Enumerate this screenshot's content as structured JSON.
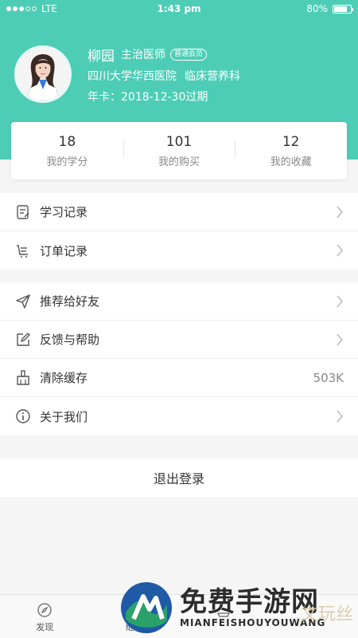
{
  "status_bar": {
    "carrier": "LTE",
    "time": "1:43 pm",
    "battery": "80%",
    "battery_level": 0.8
  },
  "profile": {
    "name": "柳园",
    "title": "主治医师",
    "membership_badge": "普通会员",
    "hospital": "四川大学华西医院",
    "department": "临床营养科",
    "card_status": "年卡：2018-12-30过期"
  },
  "stats": [
    {
      "value": "18",
      "label": "我的学分"
    },
    {
      "value": "101",
      "label": "我的购买"
    },
    {
      "value": "12",
      "label": "我的收藏"
    }
  ],
  "menu_groups": {
    "records": [
      {
        "label": "学习记录",
        "icon": "study-record-icon"
      },
      {
        "label": "订单记录",
        "icon": "order-record-icon"
      }
    ],
    "settings": [
      {
        "label": "推荐给好友",
        "icon": "share-icon"
      },
      {
        "label": "反馈与帮助",
        "icon": "feedback-icon"
      },
      {
        "label": "清除缓存",
        "icon": "clear-cache-icon",
        "value": "503K"
      },
      {
        "label": "关于我们",
        "icon": "info-icon"
      }
    ]
  },
  "logout_label": "退出登录",
  "tabs": [
    {
      "label": "发现",
      "icon": "compass-icon"
    },
    {
      "label": "继续",
      "icon": "continue-icon"
    },
    {
      "label": "",
      "icon": "study-icon"
    },
    {
      "label": "",
      "icon": "profile-icon"
    }
  ],
  "watermark": {
    "main": "免费手游网",
    "sub": "MIANFEISHOUYOUWANG",
    "side": "文玩丝",
    "colors": {
      "text": "#2c2c2c",
      "logo_blue": "#1f5aa6",
      "logo_green": "#2aa26a"
    }
  },
  "colors": {
    "header": "#4dcdb6",
    "background": "#f5f5f5",
    "text": "#333333",
    "muted": "#888888"
  }
}
